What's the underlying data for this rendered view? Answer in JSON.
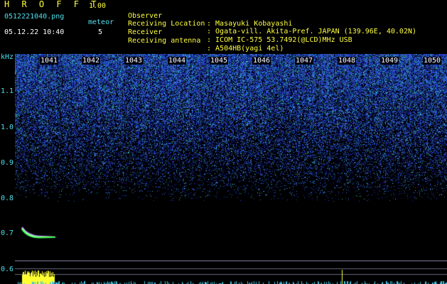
{
  "app": {
    "name": "H R O F F T",
    "version": "1.00"
  },
  "file": {
    "name": "0512221040.png",
    "timestamp": "05.12.22 10:40"
  },
  "meteor": {
    "label": "meteor",
    "count": "5"
  },
  "station": [
    {
      "label": "Observer",
      "value": ": Masayuki Kobayashi"
    },
    {
      "label": "Receiving Location",
      "value": ": Ogata-vill. Akita-Pref. JAPAN (139.96E, 40.02N)"
    },
    {
      "label": "Receiver",
      "value": ": ICOM IC-575 53.7492(@LCD)MHz USB"
    },
    {
      "label": "Receiving antenna",
      "value": ": A504HB(yagi 4el)"
    }
  ],
  "axis": {
    "unit": "kHz",
    "y_ticks": [
      "1.1",
      "1.0",
      "0.9",
      "0.8",
      "0.7",
      "0.6"
    ],
    "x_ticks": [
      "1041",
      "1042",
      "1043",
      "1044",
      "1045",
      "1046",
      "1047",
      "1048",
      "1049",
      "1050"
    ]
  },
  "colors": {
    "label_cyan": "#4fe0ee",
    "header_yellow": "#ffff40",
    "noise_blue": "#2a3cc8",
    "bg": "#000000"
  }
}
